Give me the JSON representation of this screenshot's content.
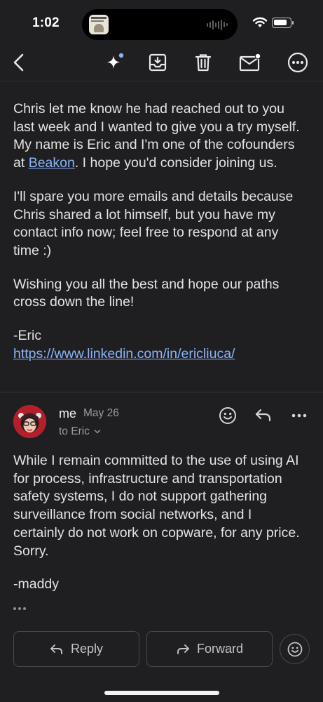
{
  "status_bar": {
    "time": "1:02",
    "island_thumbnail_icon": "book-cover-icon"
  },
  "toolbar": {
    "back_icon": "chevron-left-icon",
    "sparkle_icon": "sparkle-icon",
    "archive_icon": "archive-icon",
    "delete_icon": "trash-icon",
    "mark_unread_icon": "mail-unread-icon",
    "more_icon": "more-circle-icon"
  },
  "message_1": {
    "paragraphs": [
      {
        "before": "Chris let me know he had reached out to you last week and I wanted to give you a try myself. My name is Eric and I'm one of the cofounders at ",
        "link": "Beakon",
        "after": ". I hope you'd consider joining us."
      },
      {
        "text": "I'll spare you more emails and details because Chris shared a lot himself, but you have my contact info now; feel free to respond at any time :)"
      },
      {
        "text": "Wishing you all the best and hope our paths cross down the line!"
      }
    ],
    "signature": "-Eric",
    "signature_link": "https://www.linkedin.com/in/ericliuca/"
  },
  "message_2": {
    "sender": "me",
    "date": "May 26",
    "to": "to Eric",
    "body": "While I remain committed to the use of using AI for process, infrastructure and transportation safety systems, I do not support gathering surveillance from social networks, and I certainly do not work on copware, for any price. Sorry.",
    "signature": "-maddy"
  },
  "actions": {
    "reply_label": "Reply",
    "forward_label": "Forward"
  },
  "colors": {
    "background": "#1f1f21",
    "text": "#e3e3e3",
    "link": "#8ab4f8",
    "secondary_text": "#9a9a9a",
    "unread_dot": "#8ab4f8"
  }
}
